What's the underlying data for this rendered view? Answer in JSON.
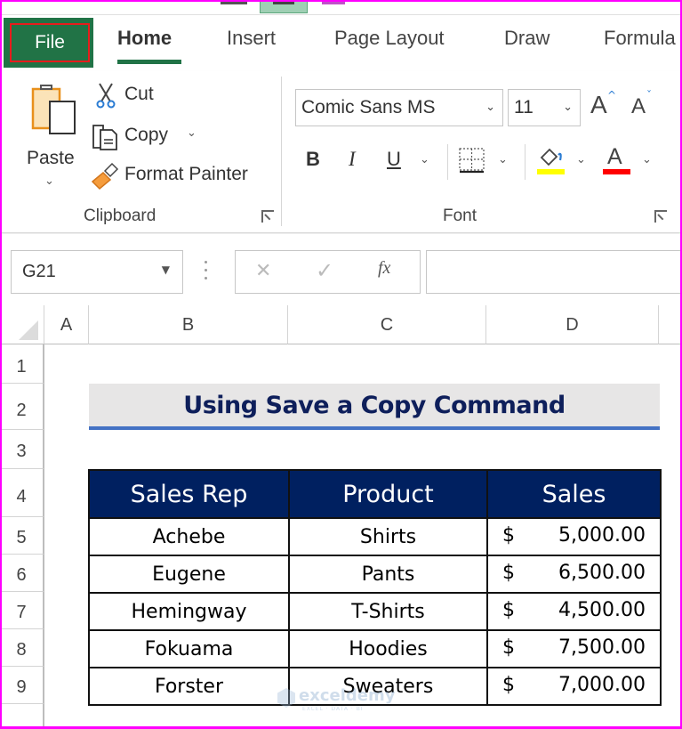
{
  "ribbon_tabs": {
    "file": "File",
    "home": "Home",
    "insert": "Insert",
    "page_layout": "Page Layout",
    "draw": "Draw",
    "formulas": "Formula"
  },
  "clipboard": {
    "paste": "Paste",
    "cut": "Cut",
    "copy": "Copy",
    "format_painter": "Format Painter",
    "group_label": "Clipboard"
  },
  "font": {
    "font_name": "Comic Sans MS",
    "font_size": "11",
    "group_label": "Font",
    "bold": "B",
    "italic": "I",
    "underline": "U",
    "grow": "A",
    "shrink": "A",
    "font_color_letter": "A",
    "fill_color": "#ffff00",
    "font_color": "#ff0000"
  },
  "formula_bar": {
    "name_box": "G21",
    "cancel": "✕",
    "enter": "✓",
    "fx": "fx",
    "formula": ""
  },
  "columns": [
    "A",
    "B",
    "C",
    "D"
  ],
  "rows": [
    "1",
    "2",
    "3",
    "4",
    "5",
    "6",
    "7",
    "8",
    "9"
  ],
  "sheet": {
    "title": "Using Save a Copy Command",
    "headers": [
      "Sales Rep",
      "Product",
      "Sales"
    ],
    "data": [
      {
        "rep": "Achebe",
        "product": "Shirts",
        "currency": "$",
        "amount": "5,000.00"
      },
      {
        "rep": "Eugene",
        "product": "Pants",
        "currency": "$",
        "amount": "6,500.00"
      },
      {
        "rep": "Hemingway",
        "product": "T-Shirts",
        "currency": "$",
        "amount": "4,500.00"
      },
      {
        "rep": "Fokuama",
        "product": "Hoodies",
        "currency": "$",
        "amount": "7,500.00"
      },
      {
        "rep": "Forster",
        "product": "Sweaters",
        "currency": "$",
        "amount": "7,000.00"
      }
    ]
  },
  "watermark": {
    "name": "exceldemy",
    "tagline": "EXCEL · DATA · BI"
  },
  "colors": {
    "excel_green": "#217346",
    "header_navy": "#002060",
    "title_fill": "#e7e6e6",
    "title_underline": "#4472c4",
    "highlight_box": "#e81c1c"
  }
}
